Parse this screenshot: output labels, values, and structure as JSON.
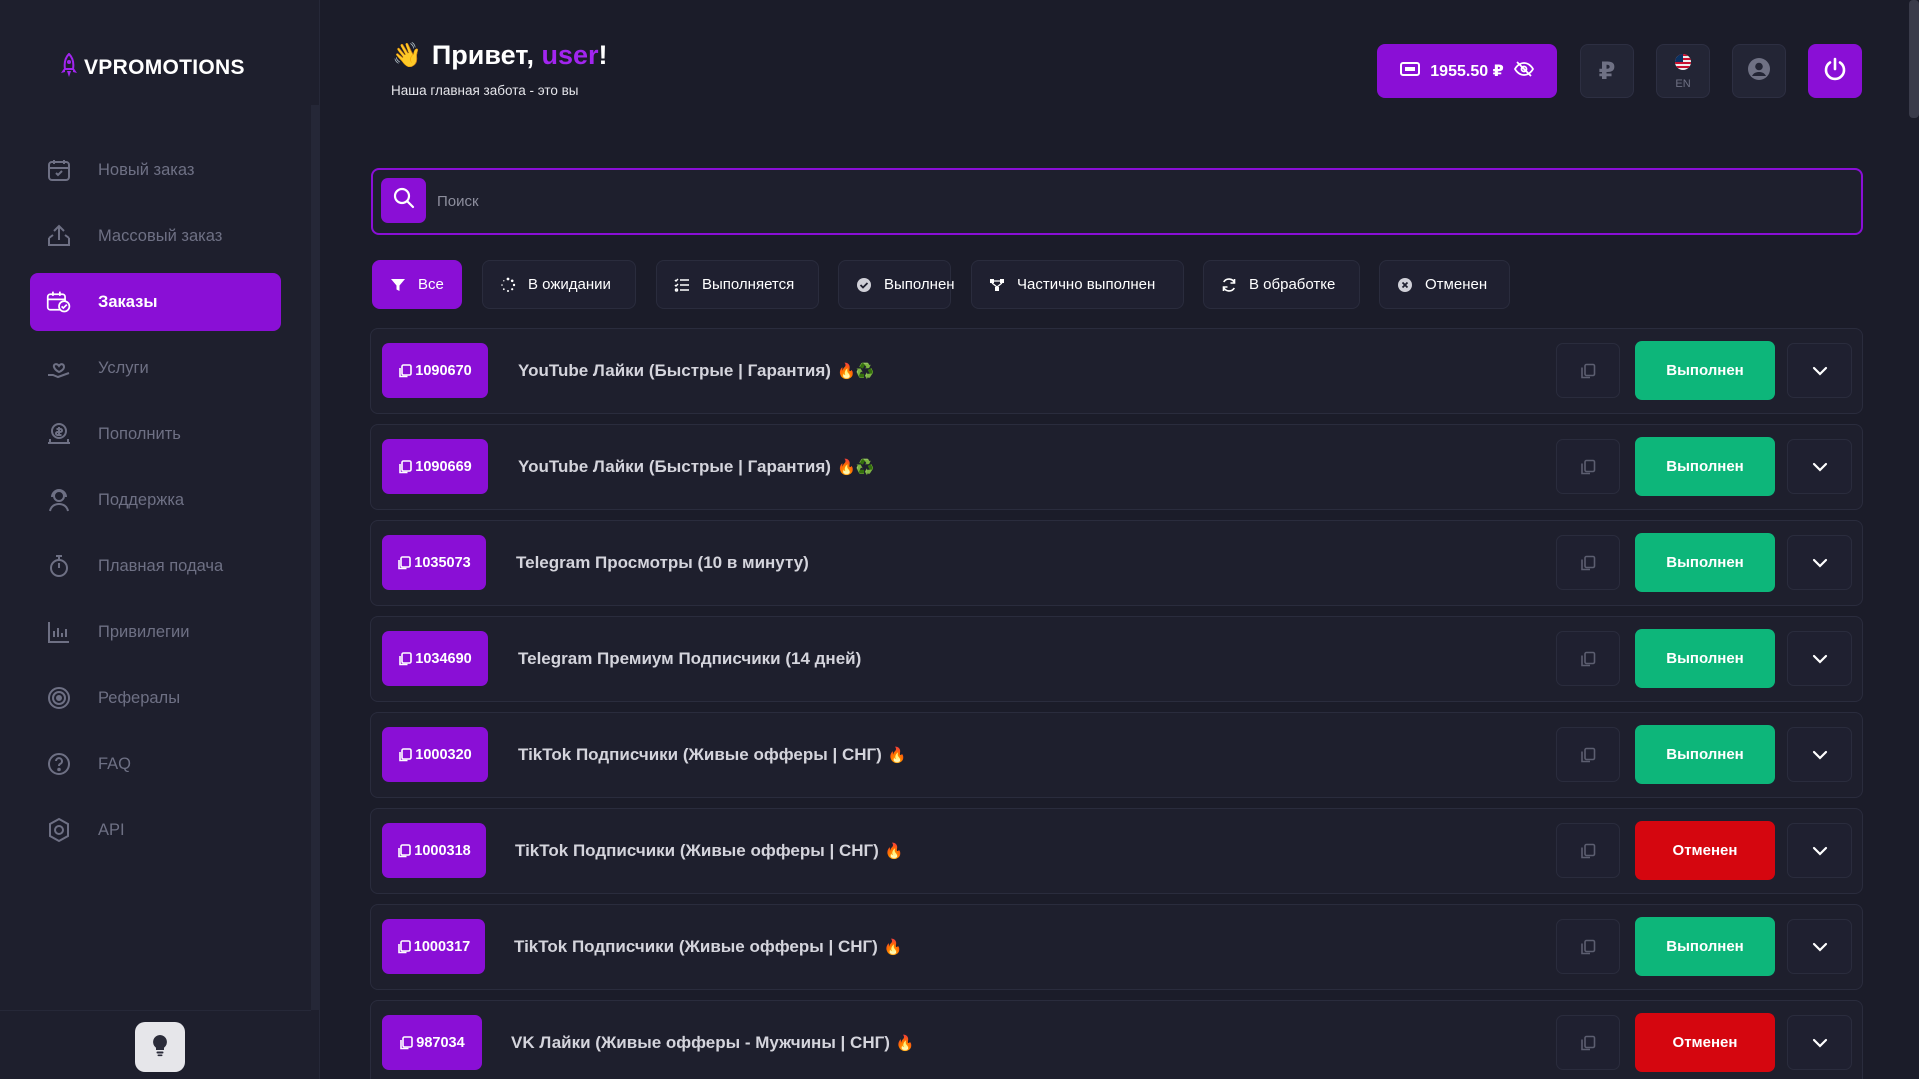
{
  "brand": {
    "name": "VPROMOTIONS"
  },
  "sidebar": {
    "items": [
      {
        "label": "Новый заказ",
        "icon": "calendar-box-icon"
      },
      {
        "label": "Массовый заказ",
        "icon": "upload-box-icon"
      },
      {
        "label": "Заказы",
        "icon": "orders-check-icon",
        "active": true
      },
      {
        "label": "Услуги",
        "icon": "hand-heart-icon"
      },
      {
        "label": "Пополнить",
        "icon": "coin-deposit-icon"
      },
      {
        "label": "Поддержка",
        "icon": "support-agent-icon"
      },
      {
        "label": "Плавная подача",
        "icon": "stopwatch-icon"
      },
      {
        "label": "Привилегии",
        "icon": "bar-chart-icon"
      },
      {
        "label": "Рефералы",
        "icon": "target-icon"
      },
      {
        "label": "FAQ",
        "icon": "question-icon"
      },
      {
        "label": "API",
        "icon": "api-hexagon-icon"
      }
    ]
  },
  "header": {
    "greeting_prefix": "Привет, ",
    "username": "user",
    "greeting_suffix": "!",
    "subtitle": "Наша главная забота - это вы",
    "balance": "1955.50 ₽",
    "currency_symbol": "₽",
    "language_code": "EN"
  },
  "search": {
    "placeholder": "Поиск",
    "value": ""
  },
  "filters": [
    {
      "label": "Все",
      "icon": "funnel-icon",
      "active": true
    },
    {
      "label": "В ожидании",
      "icon": "spinner-icon"
    },
    {
      "label": "Выполняется",
      "icon": "list-progress-icon"
    },
    {
      "label": "Выполнен",
      "icon": "check-circle-icon"
    },
    {
      "label": "Частично выполнен",
      "icon": "partial-nodes-icon"
    },
    {
      "label": "В обработке",
      "icon": "refresh-icon"
    },
    {
      "label": "Отменен",
      "icon": "x-circle-icon"
    }
  ],
  "orders": [
    {
      "id": "1090670",
      "title": "YouTube Лайки (Быстрые | Гарантия)",
      "emoji": "🔥♻️",
      "status": "Выполнен",
      "status_type": "done"
    },
    {
      "id": "1090669",
      "title": "YouTube Лайки (Быстрые | Гарантия)",
      "emoji": "🔥♻️",
      "status": "Выполнен",
      "status_type": "done"
    },
    {
      "id": "1035073",
      "title": "Telegram Просмотры (10 в минуту)",
      "emoji": "",
      "status": "Выполнен",
      "status_type": "done"
    },
    {
      "id": "1034690",
      "title": "Telegram Премиум Подписчики (14 дней)",
      "emoji": "",
      "status": "Выполнен",
      "status_type": "done"
    },
    {
      "id": "1000320",
      "title": "TikTok Подписчики (Живые офферы | СНГ)",
      "emoji": "🔥",
      "status": "Выполнен",
      "status_type": "done"
    },
    {
      "id": "1000318",
      "title": "TikTok Подписчики (Живые офферы | СНГ)",
      "emoji": "🔥",
      "status": "Отменен",
      "status_type": "cancel"
    },
    {
      "id": "1000317",
      "title": "TikTok Подписчики (Живые офферы | СНГ)",
      "emoji": "🔥",
      "status": "Выполнен",
      "status_type": "done"
    },
    {
      "id": "987034",
      "title": "VK Лайки (Живые офферы - Мужчины | СНГ)",
      "emoji": "🔥",
      "status": "Отменен",
      "status_type": "cancel"
    }
  ],
  "colors": {
    "accent": "#8a0fd6",
    "background": "#1b1c29",
    "done": "#0db67a",
    "cancel": "#d5060f"
  }
}
